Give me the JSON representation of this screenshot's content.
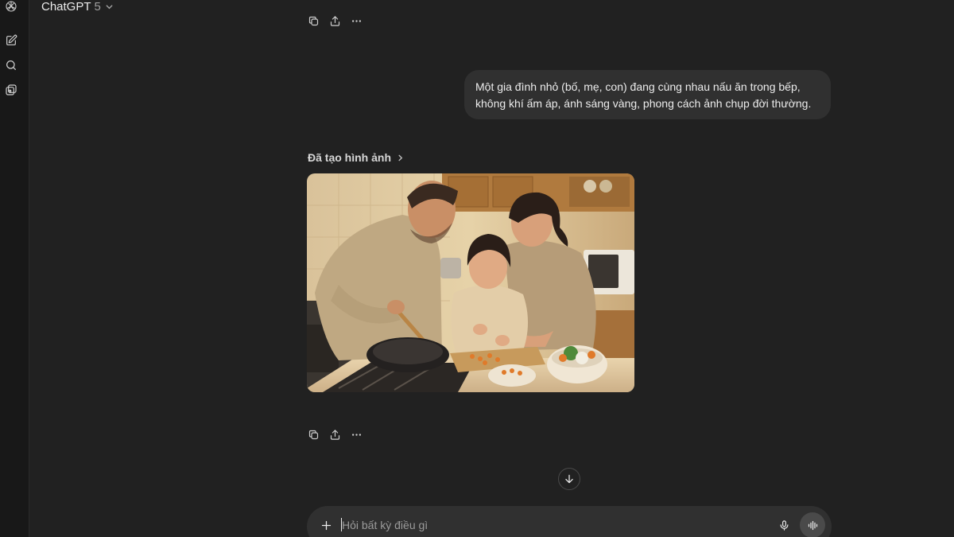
{
  "header": {
    "model_name": "ChatGPT",
    "model_version": "5"
  },
  "sidebar": {
    "items": [
      {
        "name": "new-chat",
        "icon": "edit-icon"
      },
      {
        "name": "search",
        "icon": "search-icon"
      },
      {
        "name": "library",
        "icon": "images-icon"
      }
    ]
  },
  "conversation": {
    "user_message_lines": [
      "Một gia đình nhỏ (bố, mẹ, con) đang cùng nhau nấu ăn trong bếp,",
      "không khí ấm áp, ánh sáng vàng, phong cách ảnh chụp đời thường."
    ],
    "generated_label": "Đã tạo hình ảnh"
  },
  "composer": {
    "placeholder": "Hỏi bất kỳ điều gì",
    "value": ""
  },
  "colors": {
    "background": "#212121",
    "rail": "#181818",
    "bubble": "#303030",
    "composer": "#303030",
    "text": "#ececec",
    "muted": "#a0a0a0"
  }
}
